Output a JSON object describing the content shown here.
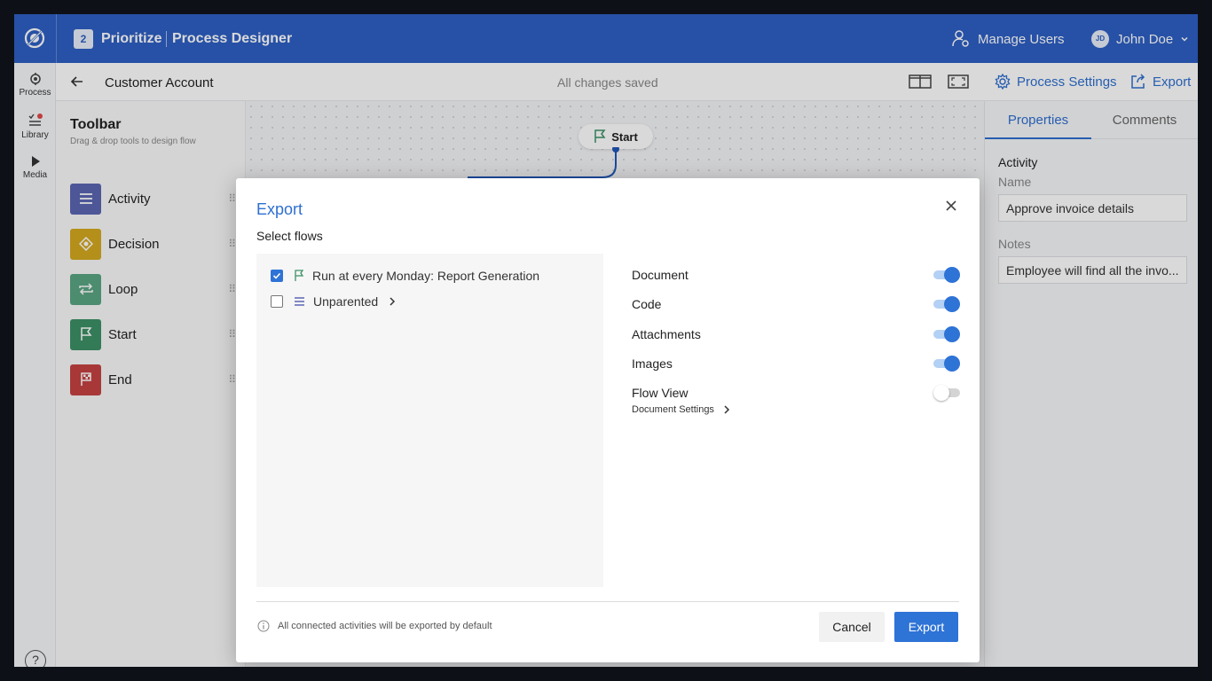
{
  "topbar": {
    "badge": "2",
    "app_name": "Prioritize",
    "app_subtitle": "Process Designer",
    "manage_users": "Manage Users",
    "user_initials": "JD",
    "user_name": "John Doe"
  },
  "rail": {
    "items": [
      {
        "label": "Process",
        "icon": "process-icon"
      },
      {
        "label": "Library",
        "icon": "library-icon"
      },
      {
        "label": "Media",
        "icon": "media-icon"
      }
    ],
    "help": "?"
  },
  "header": {
    "title": "Customer Account",
    "status": "All changes saved",
    "process_settings": "Process Settings",
    "export": "Export"
  },
  "toolbar": {
    "title": "Toolbar",
    "subtitle": "Drag & drop tools to design flow",
    "tools": [
      {
        "label": "Activity",
        "color": "#5b67b3"
      },
      {
        "label": "Decision",
        "color": "#d4a81f"
      },
      {
        "label": "Loop",
        "color": "#5aa583"
      },
      {
        "label": "Start",
        "color": "#3d9065"
      },
      {
        "label": "End",
        "color": "#c64242"
      }
    ]
  },
  "canvas": {
    "start_node": "Start"
  },
  "properties": {
    "tabs": [
      "Properties",
      "Comments"
    ],
    "section": "Activity",
    "name_label": "Name",
    "name_value": "Approve invoice details",
    "notes_label": "Notes",
    "notes_value": "Employee will find all the invo..."
  },
  "modal": {
    "title": "Export",
    "subtitle": "Select flows",
    "flows": [
      {
        "label": "Run at every Monday: Report Generation",
        "checked": true
      },
      {
        "label": "Unparented",
        "checked": false
      }
    ],
    "options": [
      {
        "label": "Document",
        "on": true
      },
      {
        "label": "Code",
        "on": true
      },
      {
        "label": "Attachments",
        "on": true
      },
      {
        "label": "Images",
        "on": true
      },
      {
        "label": "Flow View",
        "on": false
      }
    ],
    "document_settings": "Document Settings",
    "info": "All connected activities will be exported by default",
    "cancel": "Cancel",
    "export": "Export"
  },
  "colors": {
    "brand": "#2e60c3",
    "accent": "#2e73d6"
  }
}
